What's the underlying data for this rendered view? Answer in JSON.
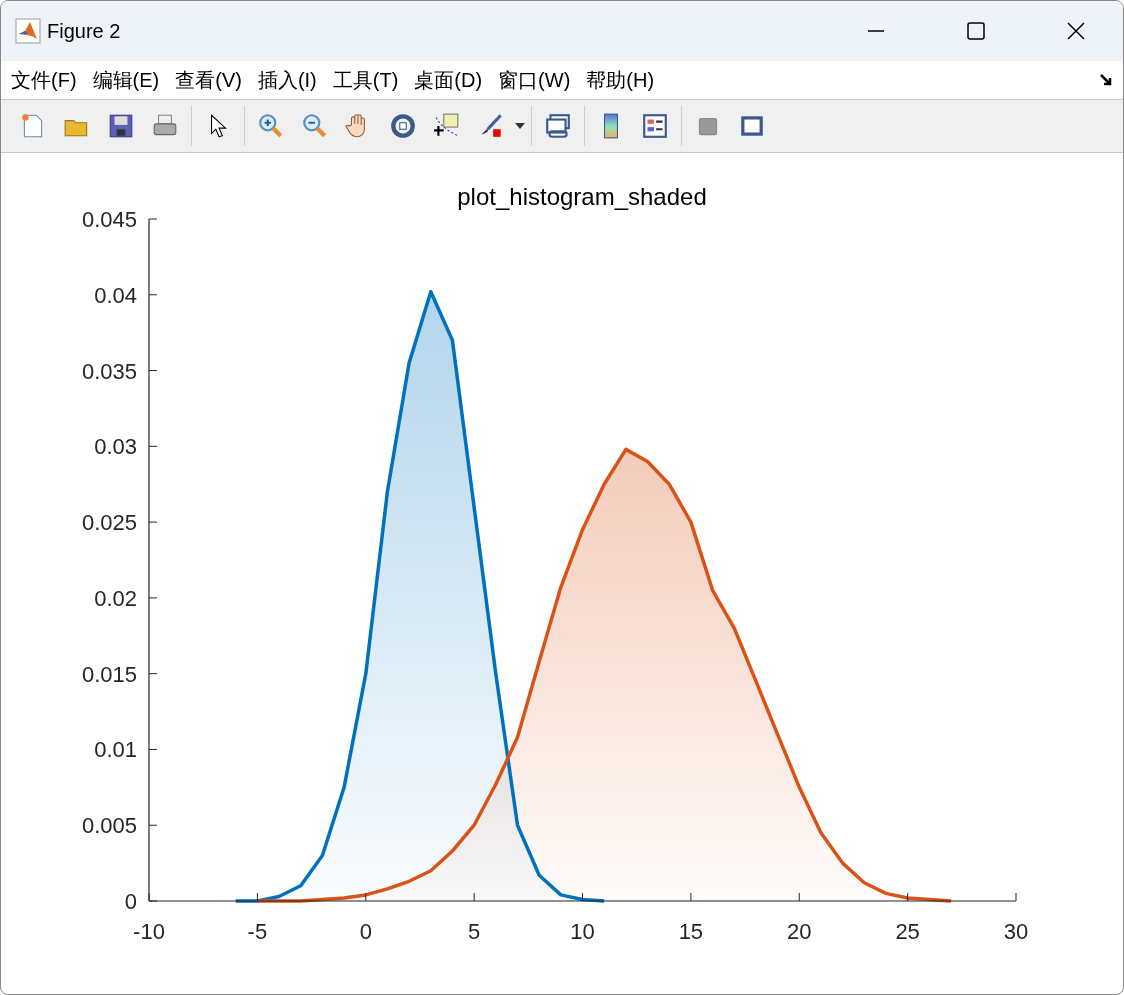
{
  "window": {
    "title": "Figure 2"
  },
  "menu": [
    "文件(F)",
    "编辑(E)",
    "查看(V)",
    "插入(I)",
    "工具(T)",
    "桌面(D)",
    "窗口(W)",
    "帮助(H)"
  ],
  "toolbar": {
    "groups": [
      [
        {
          "kind": "new"
        },
        {
          "kind": "open"
        },
        {
          "kind": "save"
        },
        {
          "kind": "print"
        }
      ],
      [
        {
          "kind": "pointer"
        }
      ],
      [
        {
          "kind": "zoom-in"
        },
        {
          "kind": "zoom-out"
        },
        {
          "kind": "pan"
        },
        {
          "kind": "rotate"
        },
        {
          "kind": "datatip"
        },
        {
          "kind": "brush"
        }
      ],
      [
        {
          "kind": "link"
        }
      ],
      [
        {
          "kind": "colorbar"
        },
        {
          "kind": "legend"
        }
      ],
      [
        {
          "kind": "hide"
        },
        {
          "kind": "frame"
        }
      ]
    ]
  },
  "chart_data": {
    "type": "area",
    "title": "plot_histogram_shaded",
    "x": [
      -6,
      -5,
      -4,
      -3,
      -2,
      -1,
      0,
      1,
      2,
      3,
      4,
      5,
      6,
      7,
      8,
      9,
      10,
      11,
      12,
      13,
      14,
      15,
      16,
      17,
      18,
      19,
      20,
      21,
      22,
      23,
      24,
      25,
      26,
      27
    ],
    "series": [
      {
        "color": "#0072bd",
        "values": [
          0,
          0,
          0.0003,
          0.001,
          0.003,
          0.0075,
          0.015,
          0.027,
          0.0355,
          0.0402,
          0.037,
          0.026,
          0.015,
          0.005,
          0.0017,
          0.0004,
          0.0001,
          0,
          null,
          null,
          null,
          null,
          null,
          null,
          null,
          null,
          null,
          null,
          null,
          null,
          null,
          null,
          null,
          null
        ]
      },
      {
        "color": "#d95319",
        "values": [
          null,
          0,
          0,
          0,
          0.0001,
          0.0002,
          0.0004,
          0.0008,
          0.0013,
          0.002,
          0.0033,
          0.005,
          0.0077,
          0.0108,
          0.0158,
          0.0207,
          0.0245,
          0.0275,
          0.0298,
          0.029,
          0.0275,
          0.025,
          0.0205,
          0.018,
          0.0145,
          0.011,
          0.0075,
          0.0045,
          0.0025,
          0.0012,
          0.0005,
          0.0002,
          0.0001,
          0
        ]
      }
    ],
    "xlim": [
      -10,
      30
    ],
    "ylim": [
      0,
      0.045
    ],
    "xticks": [
      -10,
      -5,
      0,
      5,
      10,
      15,
      20,
      25,
      30
    ],
    "yticks": [
      0,
      0.005,
      0.01,
      0.015,
      0.02,
      0.025,
      0.03,
      0.035,
      0.04,
      0.045
    ]
  }
}
